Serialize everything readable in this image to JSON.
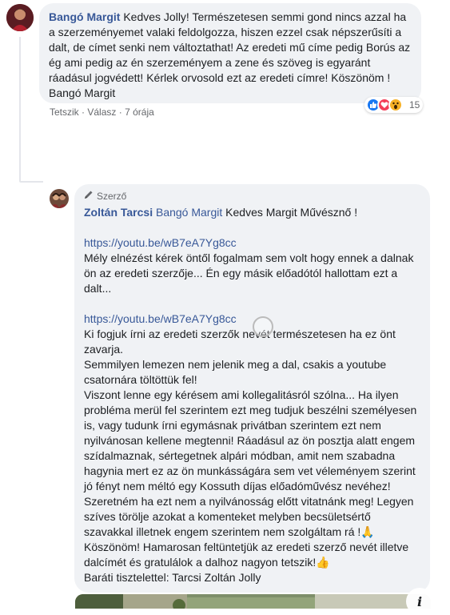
{
  "comment1": {
    "author": "Bangó Margit",
    "text": "Kedves Jolly! Természetesen semmi gond nincs azzal ha a szerzeményemet valaki feldolgozza, hiszen ezzel csak népszerűsíti a dalt, de címet senki nem változtathat! Az eredeti mű címe pedig Borús az ég ami pedig az én szerzeményem a zene és szöveg is egyaránt ráadásul jogvédett! Kérlek orvosold ezt az eredeti címre! Köszönöm ! Bangó Margit",
    "like_label": "Tetszik",
    "reply_label": "Válasz",
    "time": "7 órája",
    "reaction_count": "15",
    "reaction_colors": {
      "like": "#1877f2",
      "love": "#f33e58",
      "wow": "#f7b125"
    }
  },
  "comment2": {
    "badge": "Szerző",
    "author": "Zoltán Tarcsi",
    "mention": "Bangó Margit",
    "intro": "Kedves Margit Művésznő !",
    "link1": "https://youtu.be/wB7eA7Yg8cc",
    "para1": "Mély elnézést kérek öntől fogalmam sem volt hogy ennek a dalnak ön az eredeti szerzője... Én egy másik előadótól hallottam ezt a dalt...",
    "link2": "https://youtu.be/wB7eA7Yg8cc",
    "para2": "Ki fogjuk írni az eredeti szerzők nevét természetesen ha ez önt zavarja.",
    "para3": "Semmilyen lemezen nem jelenik meg a dal, csakis a youtube csatornára töltöttük fel!",
    "para4": "Viszont lenne egy kérésem ami kollegalitásról szólna... Ha ilyen probléma merül fel szerintem ezt meg tudjuk beszélni személyesen is, vagy tudunk írni egymásnak privátban szerintem ezt nem nyilvánosan kellene megtenni! Ráadásul az ön posztja alatt engem szídalmaznak, sértegetnek alpári módban, amit nem szabadna hagynia mert ez az ön munkásságára sem vet véleményem szerint jó fényt nem méltó egy Kossuth díjas előadóművész nevéhez!",
    "para5": "Szeretném ha ezt nem a nyilvánosság előtt vitatnánk meg! Legyen szíves törölje azokat a komenteket melyben becsületsértő szavakkal illetnek engem szerintem nem szolgáltam rá !🙏",
    "para6": "Köszönöm! Hamarosan feltüntetjük az eredeti szerző nevét illetve dalcímét és gratulálok a dalhoz nagyon tetszik!👍",
    "para7": "Baráti tisztelettel: Tarcsi Zoltán Jolly"
  },
  "attachment": {
    "more_glyph": "i"
  }
}
